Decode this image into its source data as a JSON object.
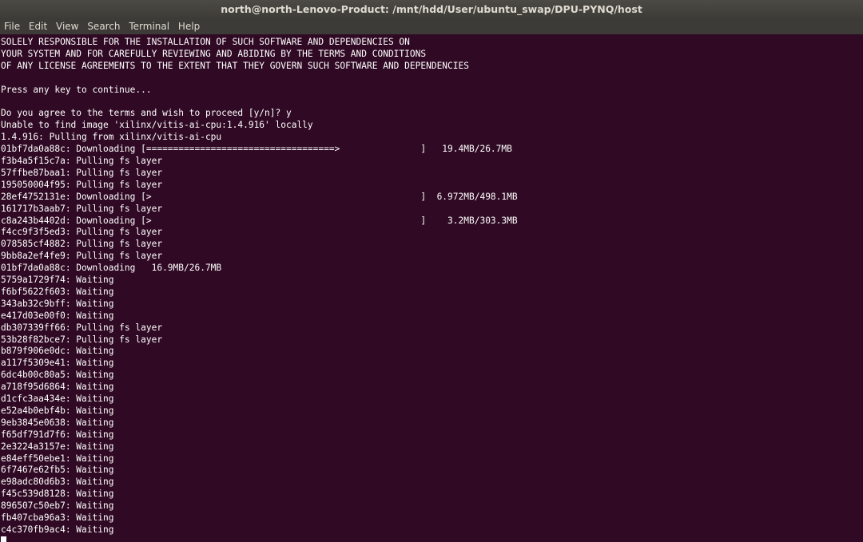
{
  "window": {
    "title": "north@north-Lenovo-Product: /mnt/hdd/User/ubuntu_swap/DPU-PYNQ/host"
  },
  "menu": {
    "items": [
      "File",
      "Edit",
      "View",
      "Search",
      "Terminal",
      "Help"
    ]
  },
  "terminal": {
    "lines": [
      "SOLELY RESPONSIBLE FOR THE INSTALLATION OF SUCH SOFTWARE AND DEPENDENCIES ON",
      "YOUR SYSTEM AND FOR CAREFULLY REVIEWING AND ABIDING BY THE TERMS AND CONDITIONS",
      "OF ANY LICENSE AGREEMENTS TO THE EXTENT THAT THEY GOVERN SUCH SOFTWARE AND DEPENDENCIES",
      "",
      "Press any key to continue...",
      "",
      "Do you agree to the terms and wish to proceed [y/n]? y",
      "Unable to find image 'xilinx/vitis-ai-cpu:1.4.916' locally",
      "1.4.916: Pulling from xilinx/vitis-ai-cpu",
      "01bf7da0a88c: Downloading [===================================>               ]   19.4MB/26.7MB",
      "f3b4a5f15c7a: Pulling fs layer",
      "57ffbe87baa1: Pulling fs layer",
      "195050004f95: Pulling fs layer",
      "28ef4752131e: Downloading [>                                                  ]  6.972MB/498.1MB",
      "161717b3aab7: Pulling fs layer",
      "c8a243b4402d: Downloading [>                                                  ]    3.2MB/303.3MB",
      "f4cc9f3f5ed3: Pulling fs layer",
      "078585cf4882: Pulling fs layer",
      "9bb8a2ef4fe9: Pulling fs layer",
      "01bf7da0a88c: Downloading   16.9MB/26.7MB",
      "5759a1729f74: Waiting",
      "f6bf5622f603: Waiting",
      "343ab32c9bff: Waiting",
      "e417d03e00f0: Waiting",
      "db307339ff66: Pulling fs layer",
      "53b28f82bce7: Pulling fs layer",
      "b879f906e0dc: Waiting",
      "a117f5309e41: Waiting",
      "6dc4b00c80a5: Waiting",
      "a718f95d6864: Waiting",
      "d1cfc3aa434e: Waiting",
      "e52a4b0ebf4b: Waiting",
      "9eb3845e0638: Waiting",
      "f65df791d7f6: Waiting",
      "2e3224a3157e: Waiting",
      "e84eff50ebe1: Waiting",
      "6f7467e62fb5: Waiting",
      "e98adc80d6b3: Waiting",
      "f45c539d8128: Waiting",
      "896507c50eb7: Waiting",
      "fb407cba96a3: Waiting",
      "c4c370fb9ac4: Waiting"
    ]
  }
}
